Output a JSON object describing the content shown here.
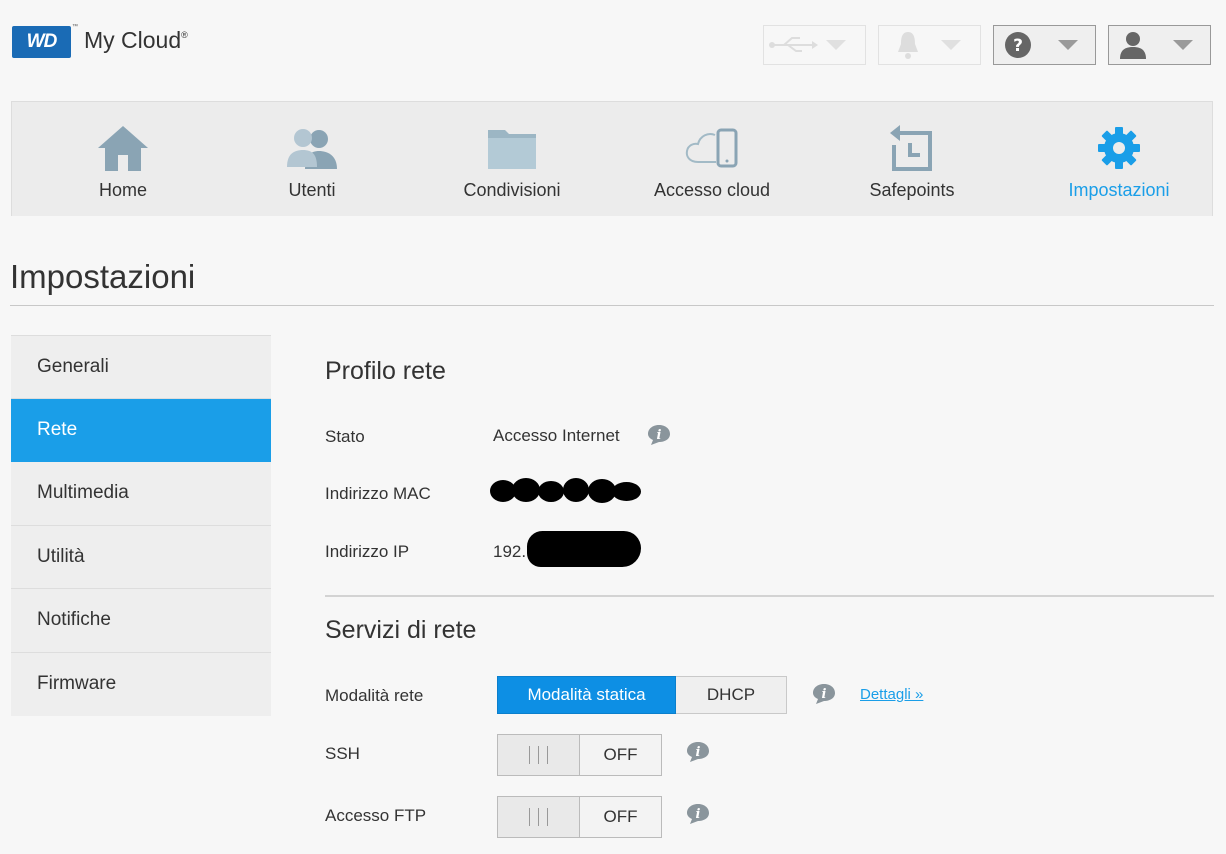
{
  "header": {
    "logo_text": "WD",
    "logo_tm": "™",
    "brand": "My Cloud",
    "brand_mark": "®",
    "buttons": [
      {
        "icon": "usb-icon"
      },
      {
        "icon": "bell-icon"
      },
      {
        "icon": "help-icon"
      },
      {
        "icon": "user-icon"
      }
    ]
  },
  "nav": {
    "items": [
      {
        "label": "Home",
        "icon": "home-icon"
      },
      {
        "label": "Utenti",
        "icon": "users-icon"
      },
      {
        "label": "Condivisioni",
        "icon": "folder-icon"
      },
      {
        "label": "Accesso cloud",
        "icon": "cloud-device-icon"
      },
      {
        "label": "Safepoints",
        "icon": "safepoint-icon"
      },
      {
        "label": "Impostazioni",
        "icon": "gear-icon"
      }
    ],
    "active_color": "#1a9ee8"
  },
  "page": {
    "title": "Impostazioni"
  },
  "sidebar": {
    "items": [
      {
        "label": "Generali"
      },
      {
        "label": "Rete"
      },
      {
        "label": "Multimedia"
      },
      {
        "label": "Utilità"
      },
      {
        "label": "Notifiche"
      },
      {
        "label": "Firmware"
      }
    ],
    "selected": "Rete"
  },
  "profile": {
    "title": "Profilo rete",
    "status_label": "Stato",
    "status_value": "Accesso Internet",
    "mac_label": "Indirizzo MAC",
    "ip_label": "Indirizzo IP",
    "ip_prefix": "192."
  },
  "services": {
    "title": "Servizi di rete",
    "mode_label": "Modalità rete",
    "mode_static": "Modalità statica",
    "mode_dhcp": "DHCP",
    "details_link": "Dettagli »",
    "ssh_label": "SSH",
    "ssh_state": "OFF",
    "ftp_label": "Accesso FTP",
    "ftp_state": "OFF"
  }
}
